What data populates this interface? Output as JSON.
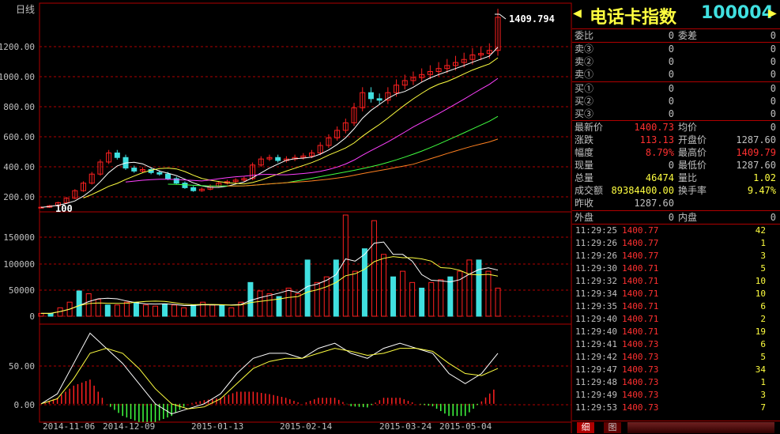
{
  "header": {
    "title": "电话卡指数",
    "code": "100004",
    "left_arrow": "◀",
    "right_arrow": "▶"
  },
  "chart": {
    "period_label": "日线",
    "peak_label": "1409.794",
    "start_label": "100",
    "price_ticks": [
      "1200.00",
      "1000.00",
      "800.00",
      "600.00",
      "400.00",
      "200.00"
    ],
    "volume_ticks": [
      "150000",
      "100000",
      "50000",
      "0"
    ],
    "macd_ticks": [
      "50.00",
      "0.00"
    ],
    "date_labels": [
      "2014-11-06",
      "2014-12-09",
      "2015-01-13",
      "2015-02-14",
      "2015-03-24",
      "2015-05-04"
    ],
    "colors": {
      "up": "#ff2020",
      "down": "#40e0e0",
      "ma5": "#ffffff",
      "ma10": "#ffff40",
      "ma20": "#ff40ff",
      "ma30": "#40ff40",
      "ma60": "#ff8020",
      "grid": "#b00000"
    }
  },
  "chart_data": [
    {
      "type": "line",
      "name": "price",
      "x_range": [
        "2014-11-06",
        "2015-05-04"
      ],
      "ylim": [
        120,
        1420
      ],
      "series": [
        {
          "name": "close",
          "values": [
            140,
            150,
            170,
            200,
            250,
            300,
            360,
            440,
            500,
            470,
            400,
            380,
            390,
            370,
            360,
            330,
            300,
            270,
            250,
            260,
            280,
            300,
            310,
            320,
            330,
            420,
            460,
            470,
            450,
            460,
            470,
            480,
            500,
            550,
            600,
            650,
            700,
            800,
            900,
            860,
            850,
            900,
            950,
            980,
            1000,
            1020,
            1040,
            1060,
            1080,
            1100,
            1120,
            1150,
            1160,
            1180,
            1400
          ]
        }
      ]
    },
    {
      "type": "bar",
      "name": "volume",
      "ylim": [
        0,
        180000
      ],
      "values": [
        5000,
        5000,
        15000,
        25000,
        45000,
        40000,
        30000,
        20000,
        20000,
        25000,
        25000,
        20000,
        18000,
        22000,
        20000,
        15000,
        20000,
        25000,
        20000,
        20000,
        15000,
        25000,
        60000,
        45000,
        40000,
        35000,
        50000,
        40000,
        100000,
        60000,
        70000,
        100000,
        180000,
        80000,
        120000,
        170000,
        110000,
        70000,
        80000,
        60000,
        50000,
        60000,
        65000,
        70000,
        80000,
        100000,
        100000,
        80000,
        50000
      ]
    },
    {
      "type": "line",
      "name": "macd",
      "ylim": [
        -15,
        75
      ],
      "series": [
        {
          "name": "dif",
          "values": [
            0,
            10,
            40,
            70,
            55,
            40,
            20,
            0,
            -10,
            -5,
            0,
            10,
            30,
            45,
            50,
            50,
            45,
            55,
            60,
            50,
            45,
            55,
            60,
            55,
            50,
            30,
            20,
            30,
            50
          ]
        },
        {
          "name": "dea",
          "values": [
            0,
            5,
            25,
            50,
            55,
            50,
            35,
            15,
            0,
            -5,
            -3,
            5,
            20,
            35,
            42,
            45,
            45,
            50,
            55,
            52,
            48,
            50,
            55,
            55,
            52,
            40,
            30,
            28,
            35
          ]
        }
      ]
    }
  ],
  "quote": {
    "r1": {
      "l1": "委比",
      "v1": "0",
      "l2": "委差",
      "v2": "0"
    },
    "sell3": {
      "l": "卖③",
      "p": "0",
      "v": "0"
    },
    "sell2": {
      "l": "卖②",
      "p": "0",
      "v": "0"
    },
    "sell1": {
      "l": "卖①",
      "p": "0",
      "v": "0"
    },
    "buy1": {
      "l": "买①",
      "p": "0",
      "v": "0"
    },
    "buy2": {
      "l": "买②",
      "p": "0",
      "v": "0"
    },
    "buy3": {
      "l": "买③",
      "p": "0",
      "v": "0"
    },
    "latest": {
      "l1": "最新价",
      "v1": "1400.73",
      "l2": "均价",
      "v2": "0"
    },
    "change": {
      "l1": "涨跌",
      "v1": "113.13",
      "l2": "开盘价",
      "v2": "1287.60"
    },
    "pct": {
      "l1": "幅度",
      "v1": "8.79%",
      "l2": "最高价",
      "v2": "1409.79"
    },
    "now": {
      "l1": "现量",
      "v1": "0",
      "l2": "最低价",
      "v2": "1287.60"
    },
    "total": {
      "l1": "总量",
      "v1": "46474",
      "l2": "量比",
      "v2": "1.02"
    },
    "amount": {
      "l1": "成交额",
      "v1": "89384400.00",
      "l2": "换手率",
      "v2": "9.47%"
    },
    "prev": {
      "l1": "昨收",
      "v1": "1287.60"
    },
    "outer": {
      "l1": "外盘",
      "v1": "0",
      "l2": "内盘",
      "v2": "0"
    }
  },
  "trades": [
    {
      "time": "11:29:25",
      "price": "1400.77",
      "vol": "42"
    },
    {
      "time": "11:29:26",
      "price": "1400.77",
      "vol": "1"
    },
    {
      "time": "11:29:26",
      "price": "1400.77",
      "vol": "3"
    },
    {
      "time": "11:29:30",
      "price": "1400.71",
      "vol": "5"
    },
    {
      "time": "11:29:32",
      "price": "1400.71",
      "vol": "10"
    },
    {
      "time": "11:29:34",
      "price": "1400.71",
      "vol": "10"
    },
    {
      "time": "11:29:35",
      "price": "1400.71",
      "vol": "6"
    },
    {
      "time": "11:29:40",
      "price": "1400.71",
      "vol": "2"
    },
    {
      "time": "11:29:40",
      "price": "1400.71",
      "vol": "19"
    },
    {
      "time": "11:29:41",
      "price": "1400.73",
      "vol": "6"
    },
    {
      "time": "11:29:42",
      "price": "1400.73",
      "vol": "5"
    },
    {
      "time": "11:29:47",
      "price": "1400.73",
      "vol": "34"
    },
    {
      "time": "11:29:48",
      "price": "1400.73",
      "vol": "1"
    },
    {
      "time": "11:29:49",
      "price": "1400.73",
      "vol": "3"
    },
    {
      "time": "11:29:53",
      "price": "1400.73",
      "vol": "7"
    }
  ],
  "tabs": {
    "detail": "细",
    "chart": "图"
  }
}
